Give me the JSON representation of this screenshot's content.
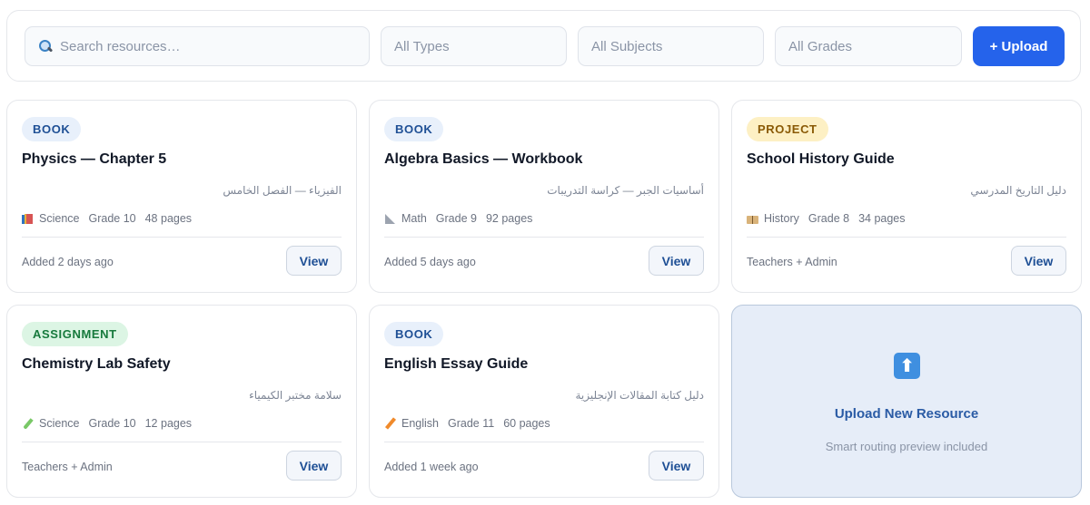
{
  "toolbar": {
    "search_placeholder": "Search resources…",
    "types_label": "All Types",
    "subjects_label": "All Subjects",
    "grades_label": "All Grades",
    "upload_label": "+ Upload"
  },
  "cards": [
    {
      "badge": "BOOK",
      "title": "Physics — Chapter 5",
      "arabic": "الفيزياء — الفصل الخامس",
      "subject_icon": "books-icon",
      "subject": "Science",
      "grade": "Grade 10",
      "pages": "48 pages",
      "footer": "Added 2 days ago",
      "view": "View"
    },
    {
      "badge": "BOOK",
      "title": "Algebra Basics — Workbook",
      "arabic": "أساسيات الجبر — كراسة التدريبات",
      "subject_icon": "ruler-icon",
      "subject": "Math",
      "grade": "Grade 9",
      "pages": "92 pages",
      "footer": "Added 5 days ago",
      "view": "View"
    },
    {
      "badge": "PROJECT",
      "title": "School History Guide",
      "arabic": "دليل التاريخ المدرسي",
      "subject_icon": "book-icon",
      "subject": "History",
      "grade": "Grade 8",
      "pages": "34 pages",
      "footer": "Teachers + Admin",
      "view": "View"
    },
    {
      "badge": "ASSIGNMENT",
      "title": "Chemistry Lab Safety",
      "arabic": "سلامة مختبر الكيمياء",
      "subject_icon": "test-tube-icon",
      "subject": "Science",
      "grade": "Grade 10",
      "pages": "12 pages",
      "footer": "Teachers + Admin",
      "view": "View"
    },
    {
      "badge": "BOOK",
      "title": "English Essay Guide",
      "arabic": "دليل كتابة المقالات الإنجليزية",
      "subject_icon": "pencil-icon",
      "subject": "English",
      "grade": "Grade 11",
      "pages": "60 pages",
      "footer": "Added 1 week ago",
      "view": "View"
    }
  ],
  "upload_card": {
    "title": "Upload New Resource",
    "subtitle": "Smart routing preview included"
  },
  "colors": {
    "accent": "#2563eb",
    "badge_book": "#e8f0fb",
    "badge_project": "#fdf0c4",
    "badge_assignment": "#dcf5e4"
  }
}
